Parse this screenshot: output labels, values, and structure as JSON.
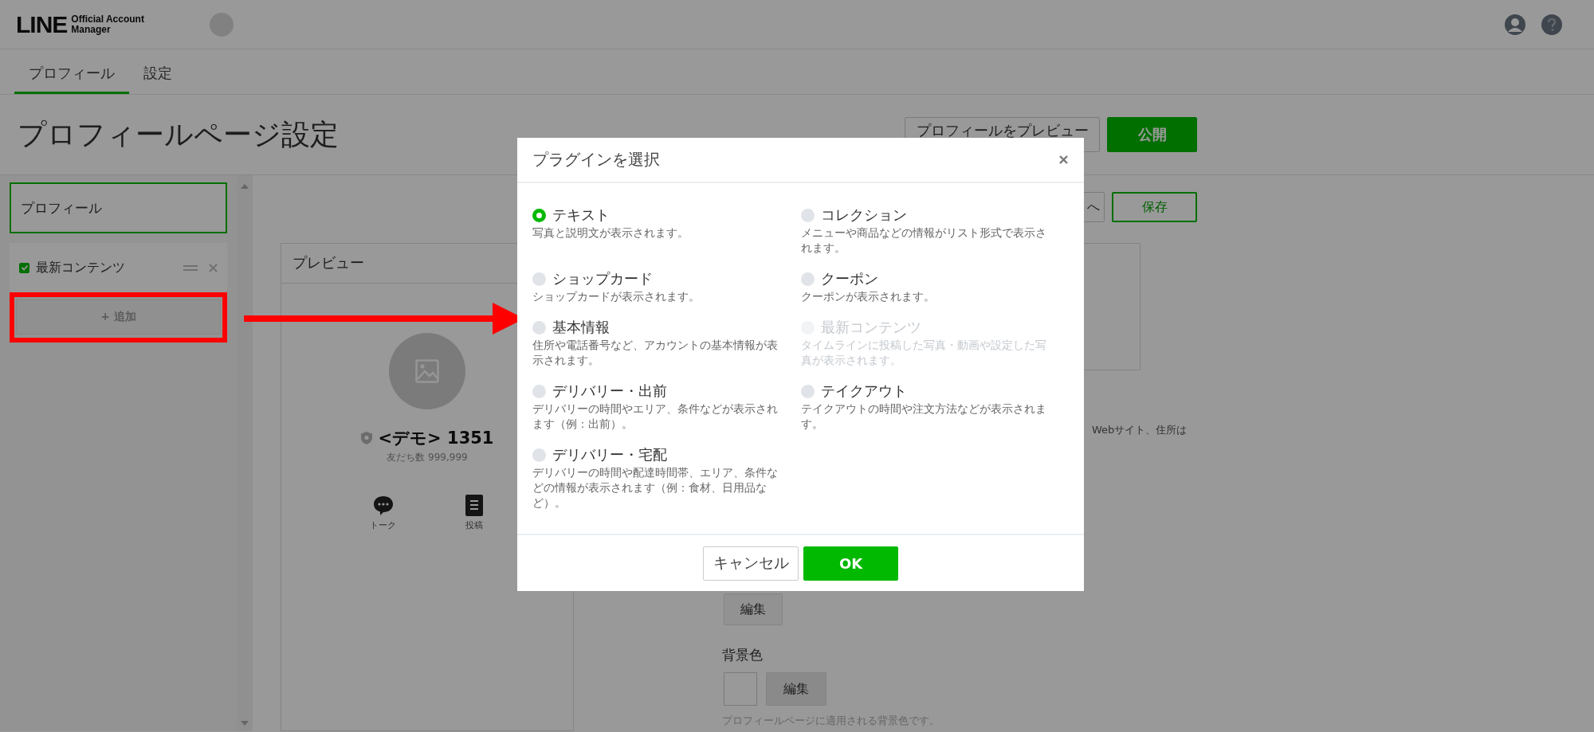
{
  "header": {
    "logo": {
      "wordmark": "LINE",
      "product": "Official Account Manager"
    }
  },
  "tabs": [
    {
      "label": "プロフィール",
      "selected": true
    },
    {
      "label": "設定",
      "selected": false
    }
  ],
  "page": {
    "title": "プロフィールページ設定",
    "actions": [
      {
        "label": "プロフィールをプレビュー",
        "kind": "outline"
      },
      {
        "label": "公開",
        "kind": "primary"
      }
    ]
  },
  "sidebar": {
    "profile": "プロフィール",
    "plugins": [
      {
        "label": "最新コンテンツ",
        "checked": true
      }
    ],
    "add": "+ 追加"
  },
  "toolbar": [
    {
      "label": "へ",
      "kind": "plain"
    },
    {
      "label": "保存",
      "kind": "outline-green"
    }
  ],
  "preview": {
    "title": "プレビュー",
    "name": "<デモ> 1351",
    "friends": "友だち数 999,999",
    "actions": [
      {
        "label": "トーク",
        "kind": "talk"
      },
      {
        "label": "投稿",
        "kind": "post"
      }
    ]
  },
  "settings": {
    "note": "Webサイト、住所は",
    "edit_button": "編集",
    "background": {
      "label": "背景色",
      "edit_button": "編集",
      "hint": "プロフィールページに適用される背景色です。"
    }
  },
  "modal": {
    "title": "プラグインを選択",
    "options": [
      {
        "label": "テキスト",
        "description": "写真と説明文が表示されます。",
        "selected": true,
        "disabled": false
      },
      {
        "label": "コレクション",
        "description": "メニューや商品などの情報がリスト形式で表示されます。",
        "selected": false,
        "disabled": false
      },
      {
        "label": "ショップカード",
        "description": "ショップカードが表示されます。",
        "selected": false,
        "disabled": false
      },
      {
        "label": "クーポン",
        "description": "クーポンが表示されます。",
        "selected": false,
        "disabled": false
      },
      {
        "label": "基本情報",
        "description": "住所や電話番号など、アカウントの基本情報が表示されます。",
        "selected": false,
        "disabled": false
      },
      {
        "label": "最新コンテンツ",
        "description": "タイムラインに投稿した写真・動画や設定した写真が表示されます。",
        "selected": false,
        "disabled": true
      },
      {
        "label": "デリバリー・出前",
        "description": "デリバリーの時間やエリア、条件などが表示されます（例：出前）。",
        "selected": false,
        "disabled": false
      },
      {
        "label": "テイクアウト",
        "description": "テイクアウトの時間や注文方法などが表示されます。",
        "selected": false,
        "disabled": false
      },
      {
        "label": "デリバリー・宅配",
        "description": "デリバリーの時間や配達時間帯、エリア、条件などの情報が表示されます（例：食材、日用品など）。",
        "selected": false,
        "disabled": false
      }
    ],
    "buttons": [
      {
        "label": "キャンセル",
        "kind": "secondary"
      },
      {
        "label": "OK",
        "kind": "primary"
      }
    ]
  }
}
